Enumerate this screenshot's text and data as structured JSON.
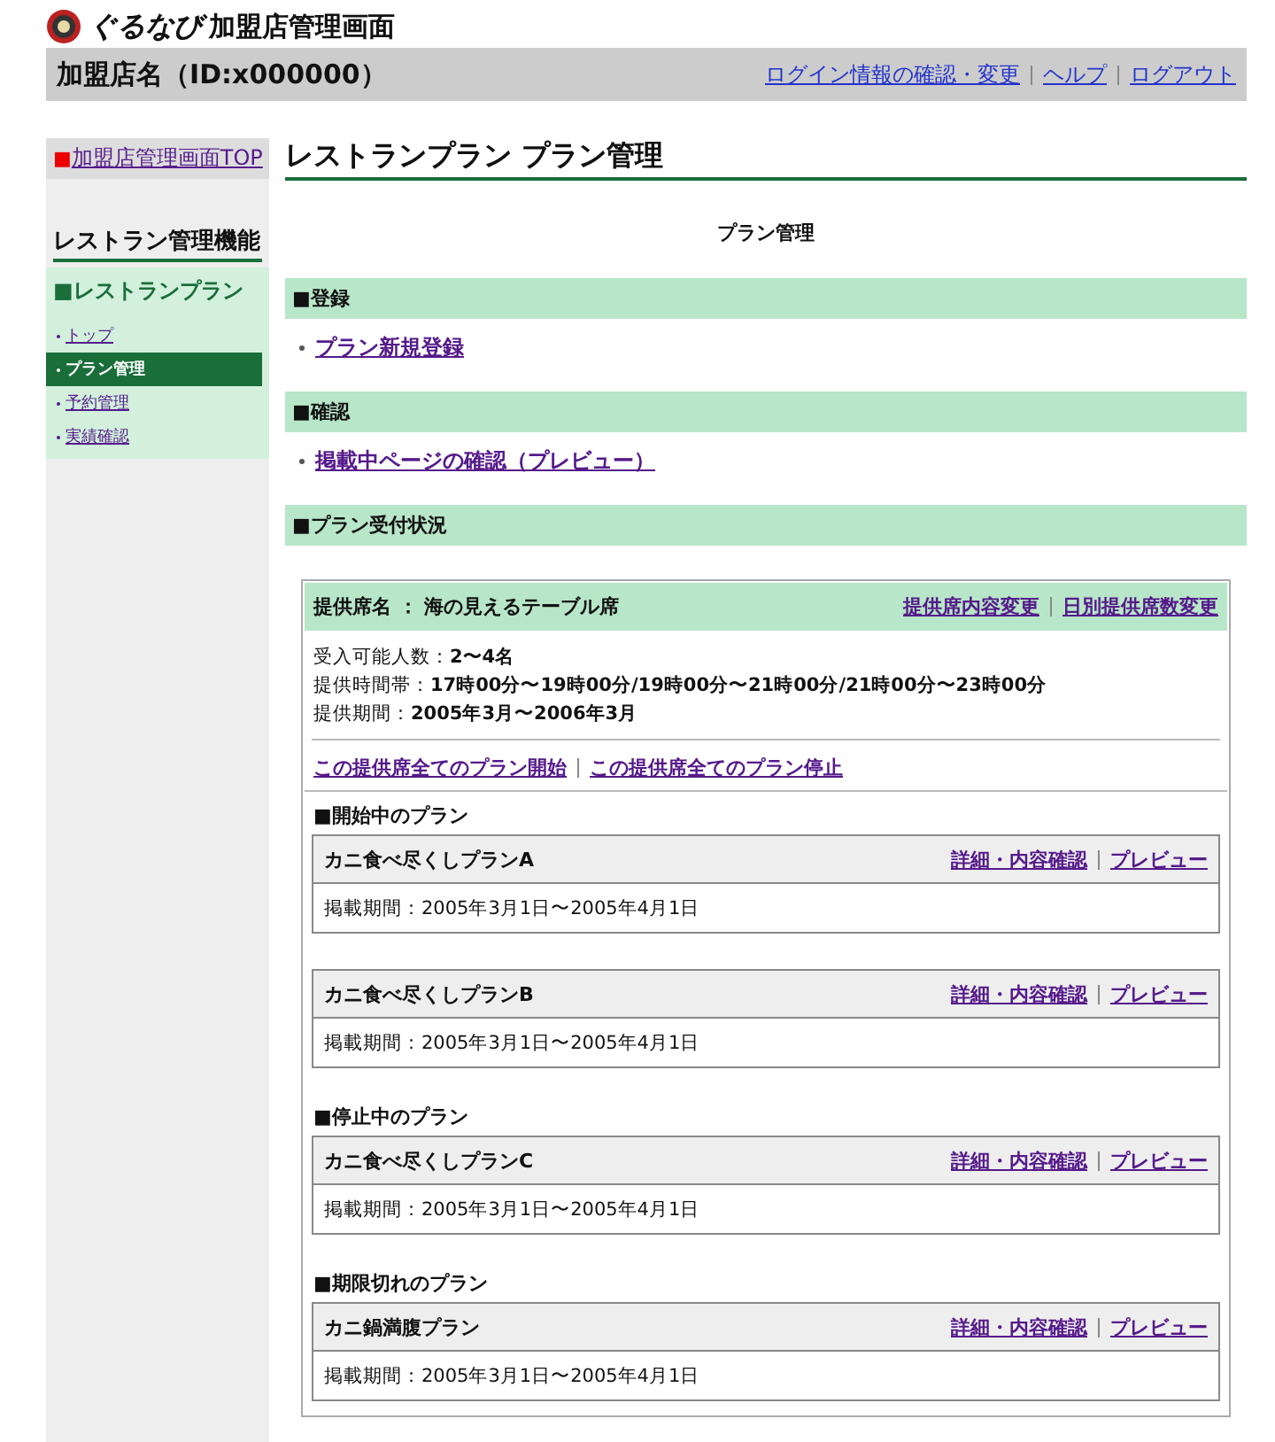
{
  "header": {
    "logo_text": "ぐるなび",
    "app_title": "加盟店管理画面",
    "shop_name": "加盟店名（ID:x000000）",
    "links": [
      "ログイン情報の確認・変更",
      "ヘルプ",
      "ログアウト"
    ]
  },
  "sidebar": {
    "top_link": {
      "marker": "■",
      "label": "加盟店管理画面TOP"
    },
    "heading": "レストラン管理機能",
    "section": "■レストランプラン",
    "items": [
      {
        "label": "トップ",
        "selected": false
      },
      {
        "label": "プラン管理",
        "selected": true
      },
      {
        "label": "予約管理",
        "selected": false
      },
      {
        "label": "実績確認",
        "selected": false
      }
    ]
  },
  "main": {
    "title": "レストランプラン プラン管理",
    "subtitle": "プラン管理",
    "sections": [
      {
        "title": "■登録",
        "links": [
          "プラン新規登録"
        ]
      },
      {
        "title": "■確認",
        "links": [
          "掲載中ページの確認（プレビュー）"
        ]
      },
      {
        "title": "■プラン受付状況"
      }
    ]
  },
  "seat": {
    "name": "提供席名 ： 海の見えるテーブル席",
    "links": [
      "提供席内容変更",
      "日別提供席数変更"
    ],
    "details": [
      "受入可能人数：**2〜4名**",
      "提供時間帯：**17時00分〜19時00分/19時00分〜21時00分/21時00分〜23時00分**",
      "提供期間：**2005年3月〜2006年3月**"
    ],
    "actions": [
      "この提供席全てのプラン開始",
      "この提供席全てのプラン停止"
    ],
    "groups": [
      {
        "title": "■開始中のプラン",
        "plans": [
          {
            "name": "カニ食べ尽くしプランA",
            "links": [
              "詳細・内容確認",
              "プレビュー"
            ],
            "period": "掲載期間：2005年3月1日〜2005年4月1日"
          },
          {
            "name": "カニ食べ尽くしプランB",
            "links": [
              "詳細・内容確認",
              "プレビュー"
            ],
            "period": "掲載期間：2005年3月1日〜2005年4月1日"
          }
        ]
      },
      {
        "title": "■停止中のプラン",
        "plans": [
          {
            "name": "カニ食べ尽くしプランC",
            "links": [
              "詳細・内容確認",
              "プレビュー"
            ],
            "period": "掲載期間：2005年3月1日〜2005年4月1日"
          }
        ]
      },
      {
        "title": "■期限切れのプラン",
        "plans": [
          {
            "name": "カニ鍋満腹プラン",
            "links": [
              "詳細・内容確認",
              "プレビュー"
            ],
            "period": "掲載期間：2005年3月1日〜2005年4月1日"
          }
        ]
      }
    ]
  }
}
